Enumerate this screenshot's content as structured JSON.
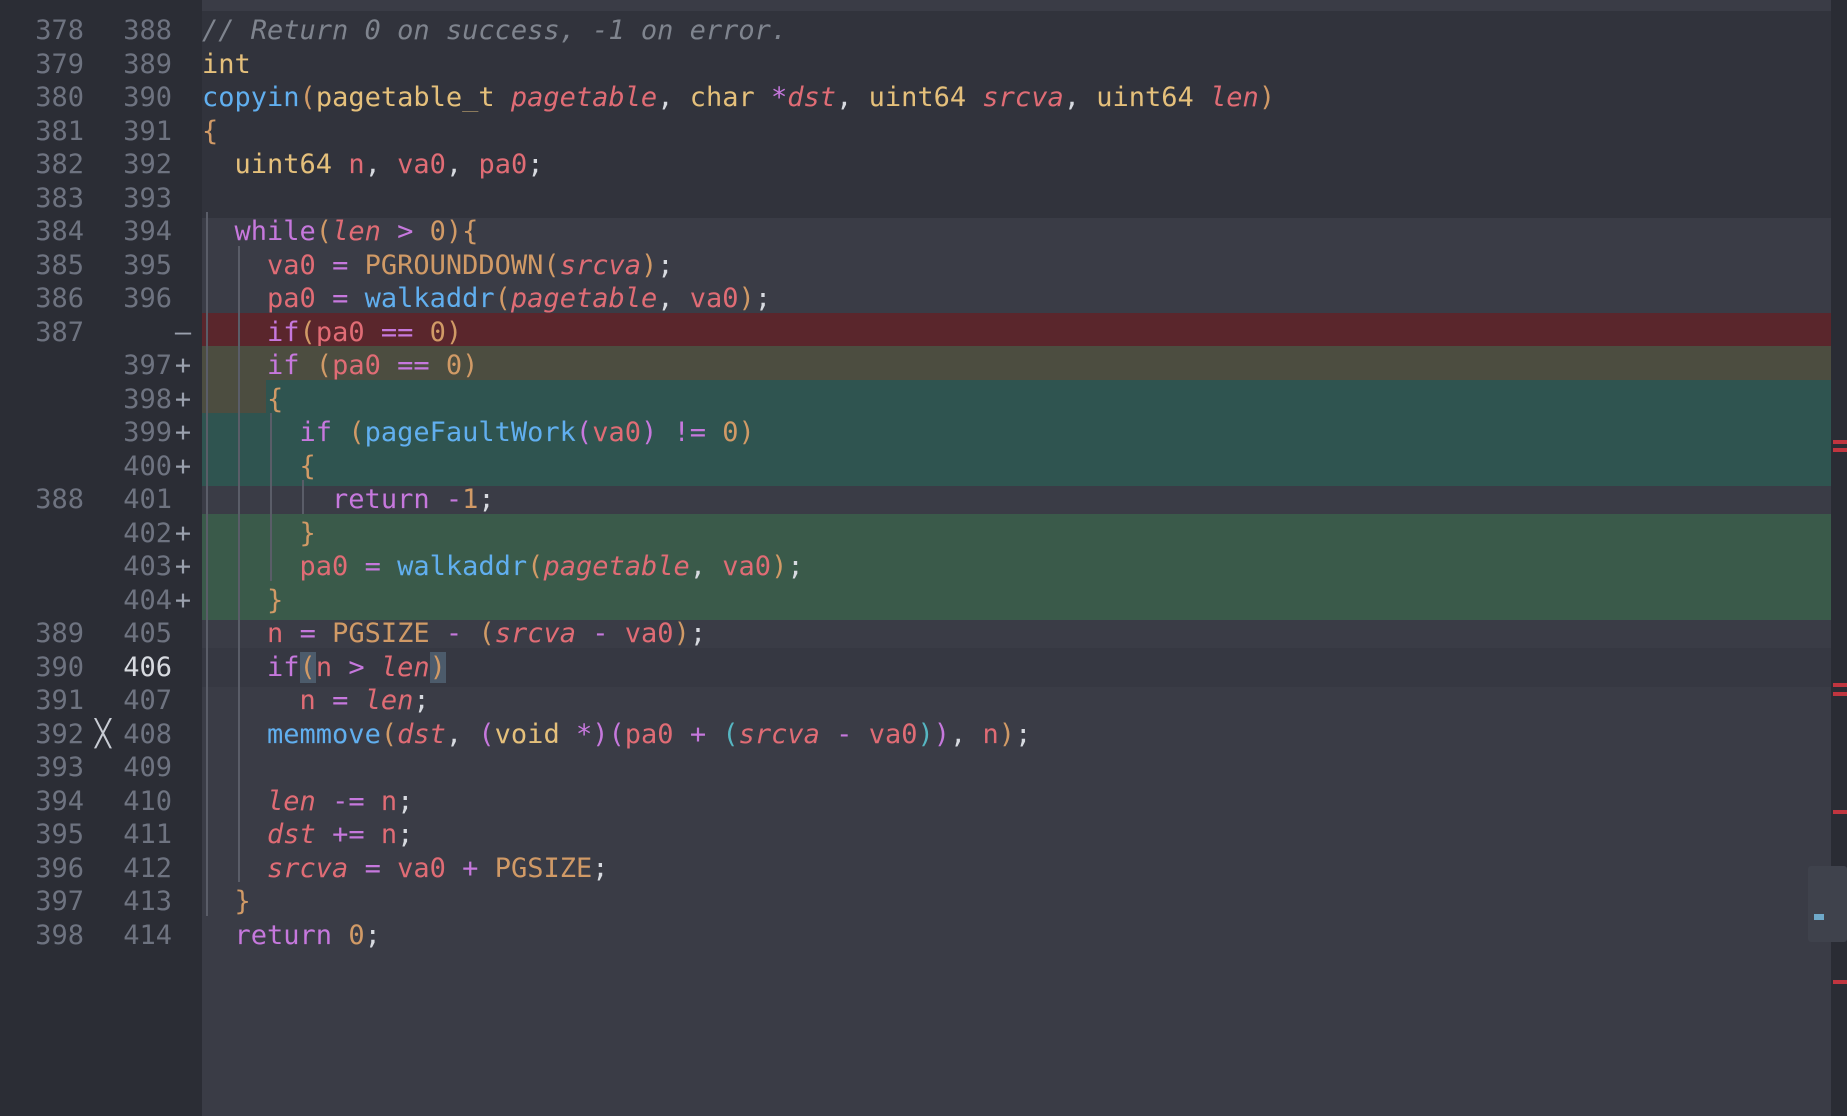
{
  "editor": {
    "colors": {
      "removed_line": "#5a262c",
      "added_line": "#3a5a4a",
      "added_line_alt": "#2f5450",
      "modified_line": "#4c4d40",
      "unchanged_band": "#31333c",
      "current_line": "#363842"
    },
    "lines": [
      {
        "old": "378",
        "new": "388",
        "marker": "",
        "text": "// Return 0 on success, -1 on error."
      },
      {
        "old": "379",
        "new": "389",
        "marker": "",
        "text": "int"
      },
      {
        "old": "380",
        "new": "390",
        "marker": "",
        "text": "copyin(pagetable_t pagetable, char *dst, uint64 srcva, uint64 len)"
      },
      {
        "old": "381",
        "new": "391",
        "marker": "",
        "text": "{"
      },
      {
        "old": "382",
        "new": "392",
        "marker": "",
        "text": "  uint64 n, va0, pa0;"
      },
      {
        "old": "383",
        "new": "393",
        "marker": "",
        "text": ""
      },
      {
        "old": "384",
        "new": "394",
        "marker": "",
        "text": "  while(len > 0){"
      },
      {
        "old": "385",
        "new": "395",
        "marker": "",
        "text": "    va0 = PGROUNDDOWN(srcva);"
      },
      {
        "old": "386",
        "new": "396",
        "marker": "",
        "text": "    pa0 = walkaddr(pagetable, va0);"
      },
      {
        "old": "387",
        "new": "",
        "marker": "—",
        "text": "    if(pa0 == 0)"
      },
      {
        "old": "",
        "new": "397",
        "marker": "+",
        "text": "    if (pa0 == 0)"
      },
      {
        "old": "",
        "new": "398",
        "marker": "+",
        "text": "    {"
      },
      {
        "old": "",
        "new": "399",
        "marker": "+",
        "text": "      if (pageFaultWork(va0) != 0)"
      },
      {
        "old": "",
        "new": "400",
        "marker": "+",
        "text": "      {"
      },
      {
        "old": "388",
        "new": "401",
        "marker": "",
        "text": "        return -1;"
      },
      {
        "old": "",
        "new": "402",
        "marker": "+",
        "text": "      }"
      },
      {
        "old": "",
        "new": "403",
        "marker": "+",
        "text": "      pa0 = walkaddr(pagetable, va0);"
      },
      {
        "old": "",
        "new": "404",
        "marker": "+",
        "text": "    }"
      },
      {
        "old": "389",
        "new": "405",
        "marker": "",
        "text": "    n = PGSIZE - (srcva - va0);"
      },
      {
        "old": "390",
        "new": "406",
        "marker": "",
        "text": "    if(n > len)"
      },
      {
        "old": "391",
        "new": "407",
        "marker": "",
        "text": "      n = len;"
      },
      {
        "old": "392",
        "new": "408",
        "marker": "",
        "text": "    memmove(dst, (void *)(pa0 + (srcva - va0)), n);"
      },
      {
        "old": "393",
        "new": "409",
        "marker": "",
        "text": ""
      },
      {
        "old": "394",
        "new": "410",
        "marker": "",
        "text": "    len -= n;"
      },
      {
        "old": "395",
        "new": "411",
        "marker": "",
        "text": "    dst += n;"
      },
      {
        "old": "396",
        "new": "412",
        "marker": "",
        "text": "    srcva = va0 + PGSIZE;"
      },
      {
        "old": "397",
        "new": "413",
        "marker": "",
        "text": "  }"
      },
      {
        "old": "398",
        "new": "414",
        "marker": "",
        "text": "  return 0;"
      }
    ]
  }
}
